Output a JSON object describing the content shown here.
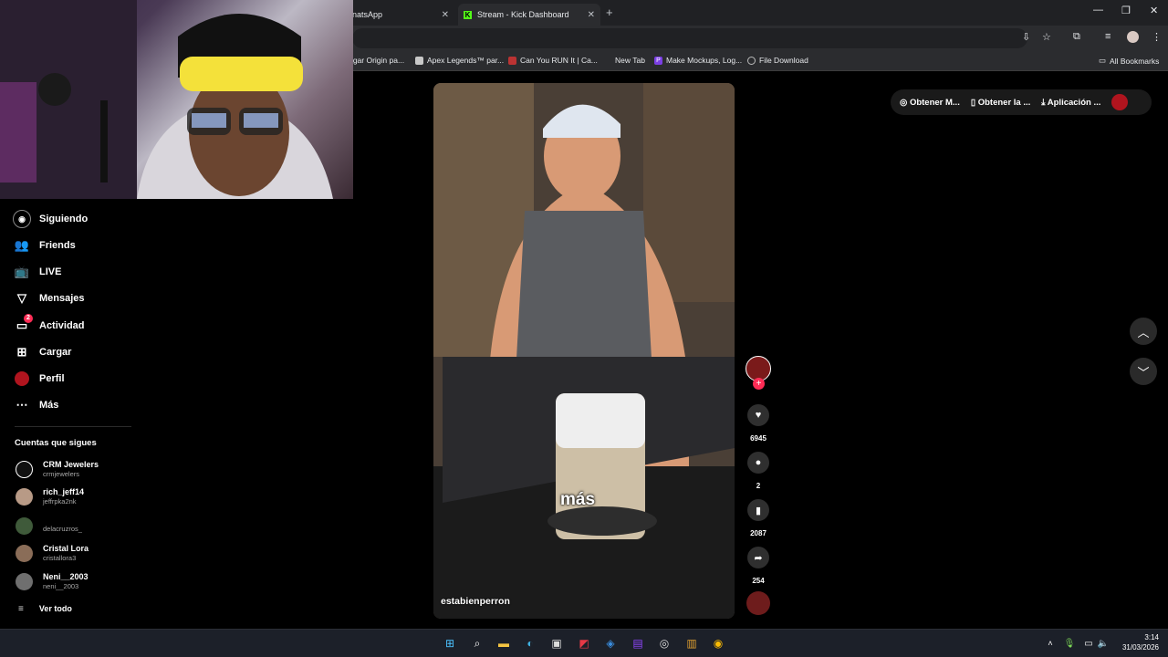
{
  "browser": {
    "tabs": [
      {
        "label": "natsApp"
      },
      {
        "label": "Stream - Kick Dashboard"
      }
    ],
    "new_tab_symbol": "+",
    "bookmarks": [
      {
        "label": "rgar Origin pa..."
      },
      {
        "label": "Apex Legends™ par..."
      },
      {
        "label": "Can You RUN It | Ca..."
      },
      {
        "label": "New Tab"
      },
      {
        "label": "Make Mockups, Log..."
      },
      {
        "label": "File Download"
      }
    ],
    "all_bookmarks": "All Bookmarks"
  },
  "sidebar": {
    "nav": [
      {
        "label": "Siguiendo",
        "icon": "following-icon"
      },
      {
        "label": "Friends",
        "icon": "friends-icon"
      },
      {
        "label": "LIVE",
        "icon": "live-icon"
      },
      {
        "label": "Mensajes",
        "icon": "messages-icon"
      },
      {
        "label": "Actividad",
        "icon": "activity-icon",
        "badge": "2"
      },
      {
        "label": "Cargar",
        "icon": "upload-icon"
      },
      {
        "label": "Perfil",
        "icon": "profile-icon"
      },
      {
        "label": "Más",
        "icon": "more-icon"
      }
    ],
    "following_title": "Cuentas que sigues",
    "accounts": [
      {
        "name": "CRM Jewelers",
        "handle": "crmjewelers",
        "color": "#111111"
      },
      {
        "name": "rich_jeff14",
        "handle": "jeffrpka2nk",
        "color": "#b89a86"
      },
      {
        "name": "",
        "handle": "delacruzros_",
        "color": "#3f5a3a"
      },
      {
        "name": "Cristal Lora",
        "handle": "cristallora3",
        "color": "#8a6d58"
      },
      {
        "name": "Neni__2003",
        "handle": "neni__2003",
        "color": "#6f6f6f"
      }
    ],
    "see_all": "Ver todo"
  },
  "video": {
    "caption": "más",
    "author": "estabienperron",
    "likes": "6945",
    "comments": "2",
    "saves": "2087",
    "shares": "254"
  },
  "top_bar": {
    "items": [
      "Obtener M...",
      "Obtener la ...",
      "Aplicación ..."
    ]
  },
  "taskbar": {
    "time": "3:14",
    "date": "31/03/2026"
  },
  "colors": {
    "like_plus": "#fe2c55",
    "badge": "#fe2c55"
  }
}
